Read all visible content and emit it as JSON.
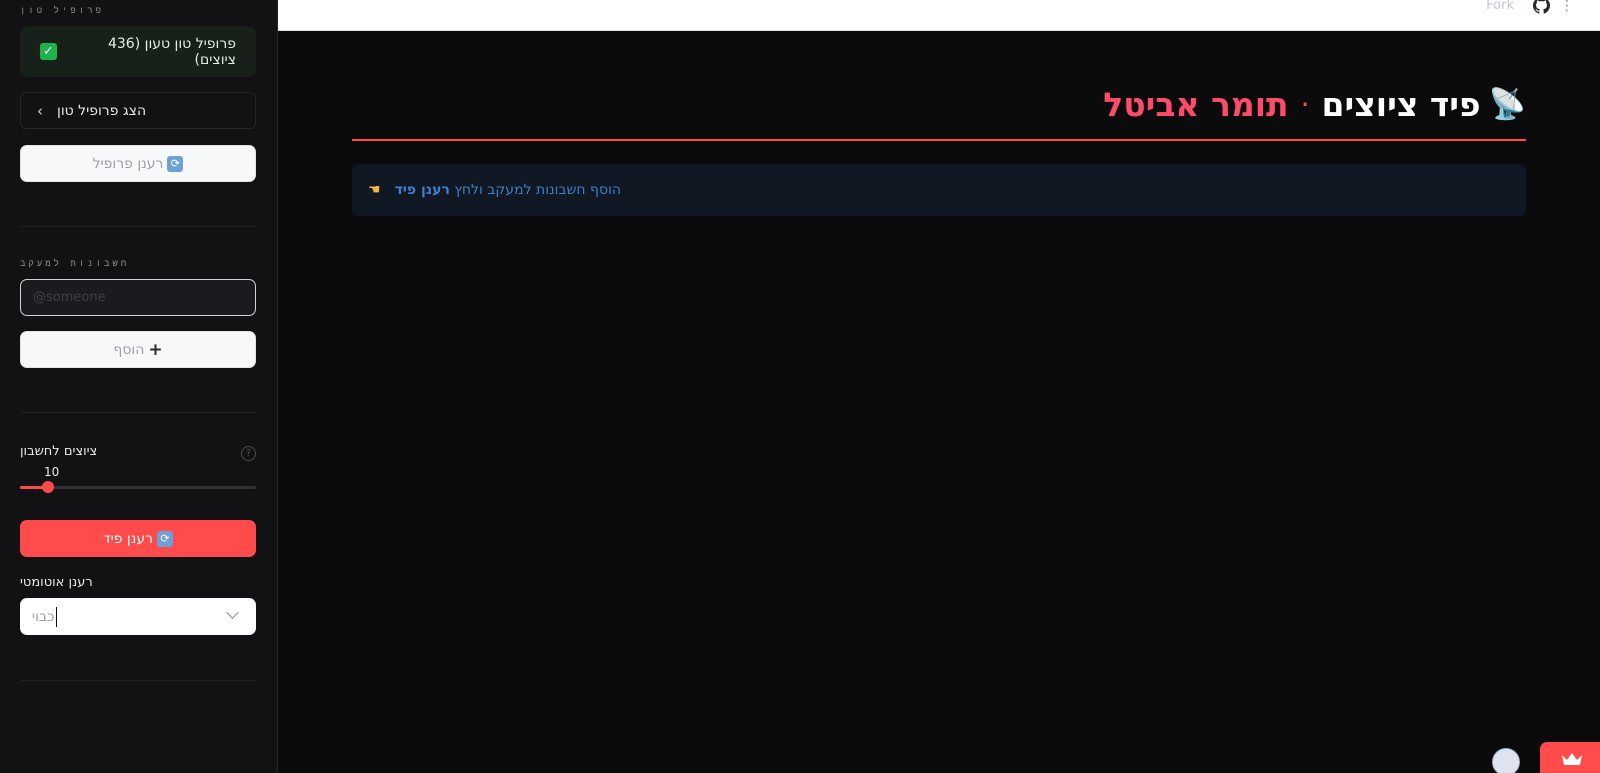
{
  "sidebar": {
    "profile_section_label": "פרופיל טון",
    "profile_status": "פרופיל טון טעון (436 ציוצים)",
    "show_profile": "הצג פרופיל טון",
    "refresh_profile": "רענן פרופיל",
    "accounts_section_label": "חשבונות למעקב",
    "account_input_placeholder": "@someone",
    "add_button": "הוסף",
    "tweets_per_account_label": "ציוצים לחשבון",
    "tweets_per_account_value": "10",
    "tweets_per_account_fraction": 0.12,
    "refresh_feed": "רענן פיד",
    "auto_refresh_label": "רענן אוטומטי",
    "auto_refresh_value": "כבוי"
  },
  "topbar": {
    "fork_label": "Fork"
  },
  "main": {
    "title_main": "פיד ציוצים",
    "title_sep": "·",
    "title_name": "תומר אביטל",
    "info_text": "הוסף חשבונות למעקב ולחץ",
    "info_bold": "רענן פיד"
  },
  "colors": {
    "accent": "#ff4b4b",
    "success_bg": "#172119",
    "info_bg": "#0f1823",
    "info_text": "#3f7fc7"
  }
}
